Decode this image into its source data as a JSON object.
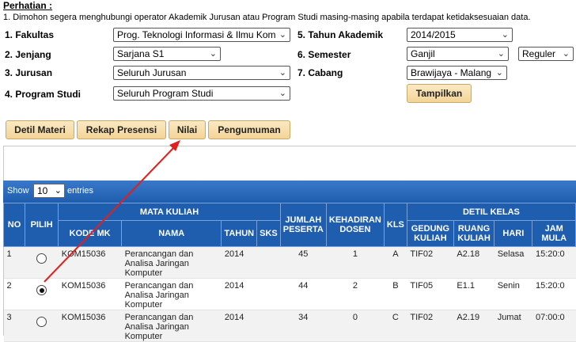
{
  "notice": {
    "title": "Perhatian :",
    "text": "1. Dimohon segera menghubungi operator Akademik Jurusan atau Program Studi masing-masing apabila terdapat ketidaksesuaian data."
  },
  "filters": {
    "fakultas": {
      "label": "1. Fakultas",
      "value": "Prog. Teknologi Informasi & Ilmu Kom"
    },
    "jenjang": {
      "label": "2. Jenjang",
      "value": "Sarjana S1"
    },
    "jurusan": {
      "label": "3. Jurusan",
      "value": "Seluruh Jurusan"
    },
    "program_studi": {
      "label": "4. Program Studi",
      "value": "Seluruh Program Studi"
    },
    "tahun_akademik": {
      "label": "5. Tahun Akademik",
      "value": "2014/2015"
    },
    "semester": {
      "label": "6. Semester",
      "value": "Ganjil",
      "type_value": "Reguler"
    },
    "cabang": {
      "label": "7. Cabang",
      "value": "Brawijaya - Malang"
    }
  },
  "buttons": {
    "tampilkan": "Tampilkan",
    "detil_materi": "Detil Materi",
    "rekap_presensi": "Rekap Presensi",
    "nilai": "Nilai",
    "pengumuman": "Pengumuman"
  },
  "table_controls": {
    "show": "Show",
    "entries_value": "10",
    "entries": "entries"
  },
  "table": {
    "headers": {
      "no": "NO",
      "pilih": "PILIH",
      "mata_kuliah": "MATA KULIAH",
      "kode_mk": "KODE MK",
      "nama": "NAMA",
      "tahun": "TAHUN",
      "sks": "SKS",
      "jumlah_peserta": "JUMLAH PESERTA",
      "kehadiran_dosen": "KEHADIRAN DOSEN",
      "kls": "KLS",
      "detil_kelas": "DETIL KELAS",
      "gedung_kuliah": "GEDUNG KULIAH",
      "ruang_kuliah": "RUANG KULIAH",
      "hari": "HARI",
      "jam_mulai": "JAM MULA"
    },
    "rows": [
      {
        "no": "1",
        "selected": false,
        "kode": "KOM15036",
        "nama": "Perancangan dan Analisa Jaringan Komputer",
        "tahun": "2014",
        "peserta": "45",
        "kehadiran": "1",
        "kls": "A",
        "gedung": "TIF02",
        "ruang": "A2.18",
        "hari": "Selasa",
        "jam": "15:20:0"
      },
      {
        "no": "2",
        "selected": true,
        "kode": "KOM15036",
        "nama": "Perancangan dan Analisa Jaringan Komputer",
        "tahun": "2014",
        "peserta": "44",
        "kehadiran": "2",
        "kls": "B",
        "gedung": "TIF05",
        "ruang": "E1.1",
        "hari": "Senin",
        "jam": "15:20:0"
      },
      {
        "no": "3",
        "selected": false,
        "kode": "KOM15036",
        "nama": "Perancangan dan Analisa Jaringan Komputer",
        "tahun": "2014",
        "peserta": "34",
        "kehadiran": "0",
        "kls": "C",
        "gedung": "TIF02",
        "ruang": "A2.19",
        "hari": "Jumat",
        "jam": "07:00:0"
      }
    ]
  },
  "colors": {
    "header_blue": "#1f5eaf",
    "button_gold": "#f3d497",
    "annotation_red": "#e0201e"
  },
  "icons": {
    "dropdown": "chevron-down-icon",
    "radio": "radio-icon",
    "annotation": "red-arrow-annotation"
  }
}
